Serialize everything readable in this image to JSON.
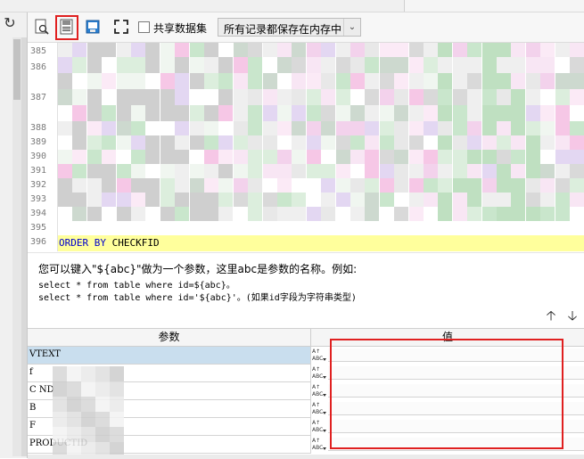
{
  "toolbar": {
    "buttons": [
      {
        "name": "preview-icon"
      },
      {
        "name": "save-sql-icon"
      },
      {
        "name": "export-icon"
      },
      {
        "name": "fullscreen-icon"
      }
    ],
    "share_dataset_label": "共享数据集",
    "share_dataset_checked": false,
    "memory_mode_value": "所有记录都保存在内存中"
  },
  "editor": {
    "line_numbers": [
      "385",
      "386",
      "387",
      "388",
      "389",
      "390",
      "391",
      "392",
      "393",
      "394",
      "395",
      "396"
    ],
    "last_line_keyword": "ORDER BY",
    "last_line_rest": " CHECKFID"
  },
  "hint": {
    "line1": "您可以键入\"${abc}\"做为一个参数，这里abc是参数的名称。例如:",
    "line2": "select * from table where id=${abc}。",
    "line3": "select * from table where id='${abc}'。(如果id字段为字符串类型)"
  },
  "param_table": {
    "columns": {
      "name": "参数",
      "value": "值"
    },
    "rows": [
      {
        "name": "VTEXT",
        "value": ""
      },
      {
        "name": "f",
        "value": ""
      },
      {
        "name": "C                    ND",
        "value": ""
      },
      {
        "name": "B",
        "value": ""
      },
      {
        "name": "F",
        "value": ""
      },
      {
        "name": "PRODUCTID",
        "value": ""
      }
    ],
    "type_icon": "abc-type-icon"
  },
  "colors": {
    "highlight_border": "#e02020",
    "keyword": "#0000cc",
    "current_line": "#ffff9c",
    "selected_row": "#c9deee"
  }
}
